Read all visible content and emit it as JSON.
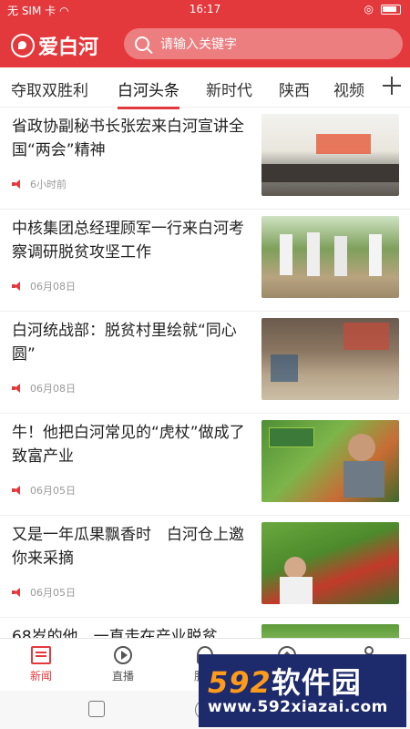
{
  "status_bar": {
    "carrier": "无 SIM 卡",
    "time": "16:17"
  },
  "header": {
    "logo_text": "爱白河",
    "search_placeholder": "请输入关键字"
  },
  "tabs": [
    {
      "label": "夺取双胜利",
      "active": false
    },
    {
      "label": "白河头条",
      "active": true
    },
    {
      "label": "新时代",
      "active": false
    },
    {
      "label": "陕西",
      "active": false
    },
    {
      "label": "视频",
      "active": false
    }
  ],
  "news": [
    {
      "title": "省政协副秘书长张宏来白河宣讲全国“两会”精神",
      "time": "6小时前"
    },
    {
      "title": "中核集团总经理顾军一行来白河考察调研脱贫攻坚工作",
      "time": "06月08日"
    },
    {
      "title": "白河统战部：脱贫村里绘就“同心圆”",
      "time": "06月08日"
    },
    {
      "title": "牛！他把白河常见的“虎杖”做成了致富产业",
      "time": "06月05日"
    },
    {
      "title": "又是一年瓜果飘香时　白河仓上邀你来采摘",
      "time": "06月05日"
    },
    {
      "title": "68岁的他，一直走在产业脱贫",
      "time": ""
    }
  ],
  "bottom_nav": [
    {
      "label": "新闻",
      "icon": "newspaper-icon",
      "active": true
    },
    {
      "label": "直播",
      "icon": "play-icon",
      "active": false
    },
    {
      "label": "服务",
      "icon": "service-icon",
      "active": false
    },
    {
      "label": "发现",
      "icon": "compass-icon",
      "active": false
    },
    {
      "label": "我的",
      "icon": "user-icon",
      "active": false
    }
  ],
  "watermark": {
    "brand_num": "592",
    "brand_text": "软件园",
    "url": "www.592xiazai.com"
  },
  "colors": {
    "accent": "#e4393c",
    "watermark_bg": "#1d2a6b",
    "watermark_num": "#ff9a1a"
  }
}
